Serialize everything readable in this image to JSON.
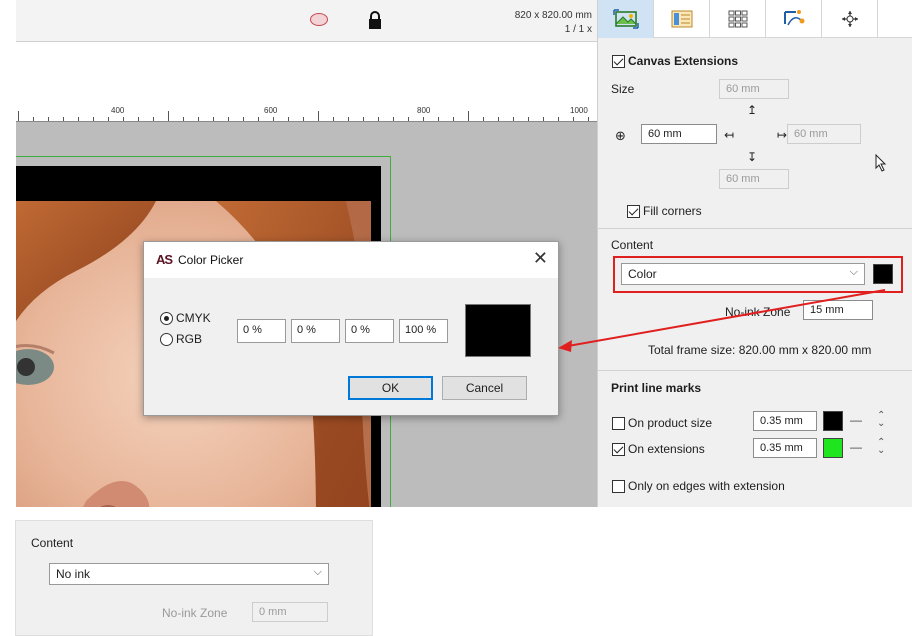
{
  "toolbar": {
    "doc_size": "820 x 820.00 mm",
    "zoom": "1 / 1 x",
    "icons": [
      "ellipse-icon",
      "lock-icon"
    ]
  },
  "ruler": {
    "labels": [
      "400",
      "600",
      "800",
      "1000"
    ]
  },
  "color_picker": {
    "logo": "AS",
    "title": "Color Picker",
    "close": "✕",
    "modes": [
      {
        "label": "CMYK",
        "selected": true
      },
      {
        "label": "RGB",
        "selected": false
      }
    ],
    "cmyk_values": [
      "0 %",
      "0 %",
      "0 %",
      "100 %"
    ],
    "preview_color": "#000000",
    "ok_label": "OK",
    "cancel_label": "Cancel"
  },
  "panel": {
    "tabs": [
      "image-tab-icon",
      "layout-tab-icon",
      "grid-tab-icon",
      "path-tab-icon",
      "crosshair-tab-icon"
    ],
    "active_tab": 0,
    "canvas_extensions": {
      "title": "Canvas Extensions",
      "checked": true,
      "size_label": "Size",
      "top": "60 mm",
      "left": "60 mm",
      "right": "60 mm",
      "bottom": "60 mm",
      "fill_corners_label": "Fill corners",
      "fill_corners_checked": true
    },
    "content": {
      "label": "Content",
      "selected": "Color",
      "swatch_color": "#000000",
      "no_ink_zone_label": "No-ink Zone",
      "no_ink_zone_value": "15 mm",
      "total_frame_size": "Total frame size:   820.00 mm x 820.00 mm"
    },
    "print_line_marks": {
      "title": "Print line marks",
      "rows": [
        {
          "label": "On product size",
          "checked": false,
          "value": "0.35 mm",
          "color": "#000000"
        },
        {
          "label": "On extensions",
          "checked": true,
          "value": "0.35 mm",
          "color": "#1ee51e"
        }
      ],
      "edges_label": "Only on edges with extension",
      "edges_checked": false
    }
  },
  "inset": {
    "content_label": "Content",
    "selected": "No ink",
    "no_ink_zone_label": "No-ink Zone",
    "no_ink_zone_value": "0 mm"
  },
  "colors": {
    "highlight": "#e0201f",
    "green_border": "#3fae3f"
  }
}
